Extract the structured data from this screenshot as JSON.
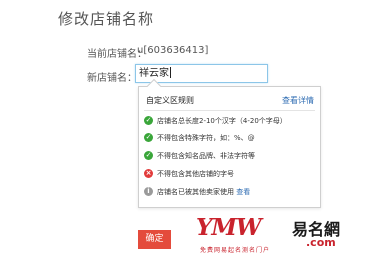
{
  "page": {
    "title": "修改店铺名称"
  },
  "form": {
    "current_label": "当前店铺名：",
    "current_value": "u[603636413]",
    "new_label": "新店铺名：",
    "new_value": "祥云家"
  },
  "rules": {
    "title": "自定义区规则",
    "details_link": "查看详情",
    "items": [
      {
        "icon": "check-icon",
        "status": "pass",
        "text": "店铺名总长度2-10个汉字（4-20个字母）"
      },
      {
        "icon": "check-icon",
        "status": "pass",
        "text": "不得包含特殊字符，如：%、@"
      },
      {
        "icon": "check-icon",
        "status": "pass",
        "text": "不得包含知名品牌、非法字符等"
      },
      {
        "icon": "cross-icon",
        "status": "fail",
        "text": "不得包含其他店铺的字号"
      },
      {
        "icon": "info-icon",
        "status": "info",
        "text": "店铺名已被其他卖家使用",
        "link": "查看"
      }
    ]
  },
  "colors": {
    "pass": "#3aa63a",
    "fail": "#e23b3b",
    "info": "#9a9a9a",
    "link": "#2f6db3",
    "button": "#e44b3c"
  },
  "button": {
    "confirm_label": "确定"
  },
  "watermark": {
    "brand": "YMW",
    "cn_name": "易名網",
    "domain": ".com",
    "slogan": "免费网易起名测名门户"
  }
}
